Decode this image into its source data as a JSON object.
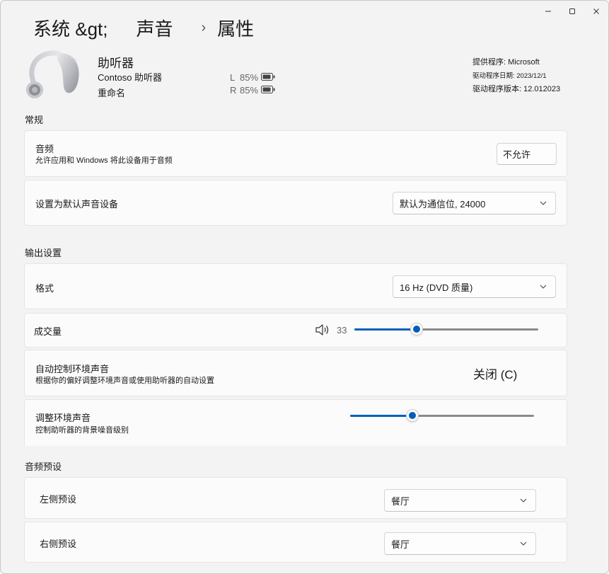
{
  "window": {
    "controls": {
      "minimize": "minimize-icon",
      "maximize": "maximize-icon",
      "close": "close-icon"
    }
  },
  "breadcrumb": {
    "segment1": "系统 &gt;",
    "segment2": "声音",
    "separator": "›",
    "segment3": "属性"
  },
  "device": {
    "name": "助听器",
    "model": "Contoso 助听器",
    "rename": "重命名",
    "battery_left_side": "L",
    "battery_left_pct": "85%",
    "battery_right_side": "R",
    "battery_right_pct": "85%",
    "battery_icon": "battery-icon"
  },
  "driver": {
    "provider": "提供程序: Microsoft",
    "date": "驱动程序日期: 2023/12/1",
    "version": "驱动程序版本: 12.012023"
  },
  "sections": {
    "general": "常规",
    "output": "输出设置",
    "presets": "音频预设"
  },
  "general": {
    "audio_title": "音频",
    "audio_desc": "允许应用和 Windows 将此设备用于音频",
    "audio_button": "不允许",
    "default_title": "设置为默认声音设备",
    "default_value": "默认为通信位, 24000"
  },
  "output": {
    "format_title": "格式",
    "format_value": "16 Hz (DVD 质量)",
    "volume_title": "成交量",
    "volume_value": "33",
    "volume_level_percent": 34,
    "ambient_auto_title": "自动控制环境声音",
    "ambient_auto_desc": "根据你的偏好调整环境声音或使用助听器的自动设置",
    "ambient_auto_state": "关闭 (C)",
    "ambient_adjust_title": "调整环境声音",
    "ambient_adjust_desc": "控制助听器的背景噪音级别",
    "ambient_adjust_level_percent": 34
  },
  "presets": {
    "left_title": "左侧预设",
    "left_value": "餐厅",
    "right_title": "右侧预设",
    "right_value": "餐厅"
  },
  "colors": {
    "accent": "#005fb8",
    "background": "#f3f3f3",
    "card": "#fbfbfb"
  }
}
